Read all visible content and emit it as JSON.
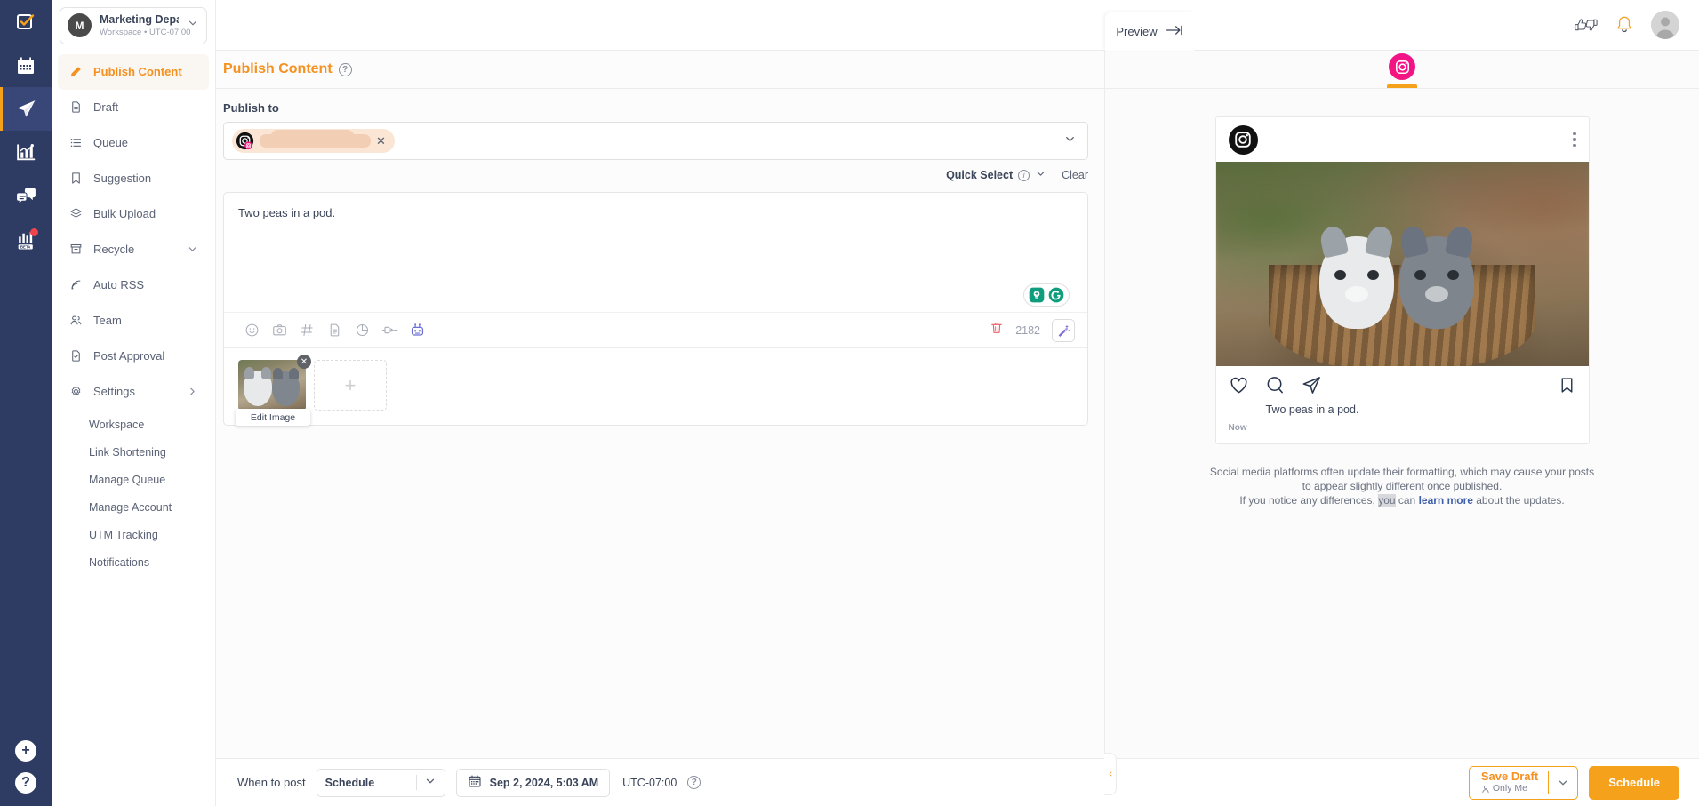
{
  "rail": {
    "items": [
      {
        "name": "tasks-icon",
        "label": "Tasks"
      },
      {
        "name": "calendar-icon",
        "label": "Calendar"
      },
      {
        "name": "publish-icon",
        "label": "Publish",
        "active": true
      },
      {
        "name": "analytics-icon",
        "label": "Analytics"
      },
      {
        "name": "inbox-icon",
        "label": "Inbox"
      },
      {
        "name": "reports-beta-icon",
        "label": "Reports",
        "badge": "BETA",
        "dot": true
      }
    ],
    "bottom": [
      {
        "name": "add-icon",
        "glyph": "+"
      },
      {
        "name": "help-icon",
        "glyph": "?"
      }
    ]
  },
  "workspace": {
    "initial": "M",
    "name": "Marketing Depart...",
    "subtitle": "Workspace • UTC-07:00"
  },
  "sidebar": {
    "items": [
      {
        "label": "Publish Content",
        "icon": "pencil-icon",
        "active": true
      },
      {
        "label": "Draft",
        "icon": "document-icon"
      },
      {
        "label": "Queue",
        "icon": "list-icon"
      },
      {
        "label": "Suggestion",
        "icon": "bookmark-icon"
      },
      {
        "label": "Bulk Upload",
        "icon": "layers-icon"
      },
      {
        "label": "Recycle",
        "icon": "archive-icon",
        "arrow": "chevron-down"
      },
      {
        "label": "Auto RSS",
        "icon": "rss-icon"
      },
      {
        "label": "Team",
        "icon": "users-icon"
      },
      {
        "label": "Post Approval",
        "icon": "approval-icon"
      },
      {
        "label": "Settings",
        "icon": "gear-icon",
        "arrow": "chevron-right"
      }
    ],
    "sub_items": [
      {
        "label": "Workspace"
      },
      {
        "label": "Link Shortening"
      },
      {
        "label": "Manage Queue"
      },
      {
        "label": "Manage Account"
      },
      {
        "label": "UTM Tracking"
      },
      {
        "label": "Notifications"
      }
    ]
  },
  "topbar": {
    "icons": [
      {
        "name": "thumbs-up-down-icon"
      },
      {
        "name": "notification-bell-icon"
      },
      {
        "name": "user-avatar"
      }
    ]
  },
  "editor": {
    "title": "Publish Content",
    "help": "?",
    "publish_to_label": "Publish to",
    "account_chip": {
      "platform": "instagram",
      "name_redacted": true,
      "remove": "✕"
    },
    "quick_select": "Quick Select",
    "quick_select_info": "i",
    "clear": "Clear",
    "compose_text": "Two peas in a pod.",
    "char_count": "2182",
    "toolbar_icons": [
      {
        "name": "emoji-icon"
      },
      {
        "name": "camera-icon"
      },
      {
        "name": "hashtag-icon"
      },
      {
        "name": "template-icon"
      },
      {
        "name": "chart-icon"
      },
      {
        "name": "plugin-icon"
      },
      {
        "name": "ai-robot-icon"
      }
    ],
    "grammarly_icons": [
      {
        "name": "grammarly-suggestion-icon"
      },
      {
        "name": "grammarly-logo-icon"
      }
    ],
    "right_icons": [
      {
        "name": "delete-icon"
      },
      {
        "name": "magic-wand-icon"
      }
    ],
    "media": {
      "edit_image_label": "Edit Image",
      "remove": "✕",
      "add_media": "+"
    }
  },
  "preview": {
    "button_label": "Preview",
    "tab": {
      "platform": "instagram",
      "name": "instagram-tab"
    },
    "post": {
      "caption": "Two peas in a pod.",
      "time": "Now",
      "actions": [
        {
          "name": "like-heart-icon"
        },
        {
          "name": "comment-icon"
        },
        {
          "name": "share-icon"
        },
        {
          "name": "bookmark-icon"
        }
      ],
      "menu": "more-options-icon"
    },
    "disclaimer": {
      "line1": "Social media platforms often update their formatting, which may cause your posts",
      "line2": "to appear slightly different once published.",
      "line3_a": "If you notice any differences, ",
      "line3_selected": "you",
      "line3_b": " can ",
      "line3_link": "learn more",
      "line3_c": " about the updates."
    }
  },
  "bottombar": {
    "when_to_post": "When to post",
    "schedule_mode": "Schedule",
    "date_value": "Sep 2, 2024, 5:03 AM",
    "timezone": "UTC-07:00",
    "tz_help": "?",
    "save_draft": "Save Draft",
    "save_draft_sub": "Only Me",
    "schedule_button": "Schedule"
  },
  "colors": {
    "accent": "#f5a11c",
    "rail_bg": "#2e3b63",
    "instagram": "#f5157e",
    "link": "#3f5fa8"
  }
}
